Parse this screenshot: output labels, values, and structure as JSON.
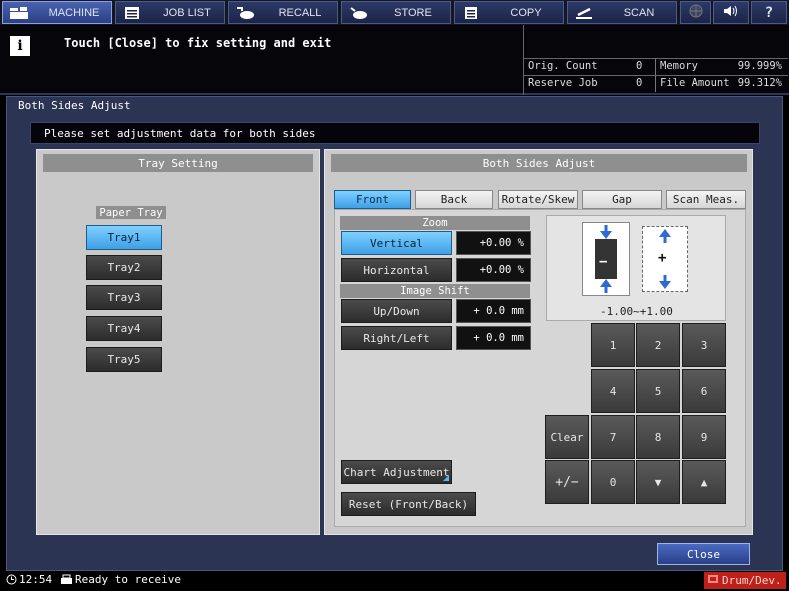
{
  "menu": {
    "tabs": [
      {
        "label": "MACHINE",
        "icon": "machine-icon",
        "selected": true
      },
      {
        "label": "JOB LIST",
        "icon": "list-icon"
      },
      {
        "label": "RECALL",
        "icon": "recall-icon"
      },
      {
        "label": "STORE",
        "icon": "store-icon"
      },
      {
        "label": "COPY",
        "icon": "copy-icon"
      },
      {
        "label": "SCAN",
        "icon": "scan-icon"
      }
    ]
  },
  "message": {
    "text": "Touch [Close] to fix setting and exit"
  },
  "counters": {
    "orig_count_label": "Orig. Count",
    "orig_count_value": "0",
    "reserve_job_label": "Reserve Job",
    "reserve_job_value": "0",
    "memory_label": "Memory",
    "memory_value": "99.999%",
    "file_amount_label": "File Amount",
    "file_amount_value": "99.312%"
  },
  "dialog": {
    "title": "Both Sides Adjust",
    "instruction": "Please set adjustment data for both sides",
    "close_label": "Close"
  },
  "tray_setting": {
    "title": "Tray Setting",
    "paper_tray_label": "Paper Tray",
    "trays": [
      "Tray1",
      "Tray2",
      "Tray3",
      "Tray4",
      "Tray5"
    ],
    "selected": "Tray1"
  },
  "adjust": {
    "title": "Both Sides Adjust",
    "tabs": [
      "Front",
      "Back",
      "Rotate/Skew",
      "Gap",
      "Scan Meas."
    ],
    "selected_tab": "Front",
    "zoom_label": "Zoom",
    "vertical_label": "Vertical",
    "vertical_value": "+0.00 %",
    "horizontal_label": "Horizontal",
    "horizontal_value": "+0.00 %",
    "image_shift_label": "Image Shift",
    "updown_label": "Up/Down",
    "updown_value": "+ 0.0 mm",
    "rightleft_label": "Right/Left",
    "rightleft_value": "+ 0.0 mm",
    "range_label": "-1.00~+1.00",
    "minus_symbol": "−",
    "plus_symbol": "+",
    "chart_adjustment_label": "Chart Adjustment",
    "reset_label": "Reset (Front/Back)"
  },
  "keypad": {
    "keys": [
      "1",
      "2",
      "3",
      "4",
      "5",
      "6",
      "7",
      "8",
      "9",
      "0"
    ],
    "clear_label": "Clear",
    "plusminus_label": "+/−",
    "down_symbol": "▼",
    "up_symbol": "▲"
  },
  "status": {
    "time": "12:54",
    "ready_text": "Ready to receive",
    "warning_text": "Drum/Dev."
  },
  "colors": {
    "accent_blue": "#3ea0e6",
    "panel_grey": "#c9c9c9",
    "background_navy": "#2b3452",
    "warning_red": "#c0201a"
  }
}
